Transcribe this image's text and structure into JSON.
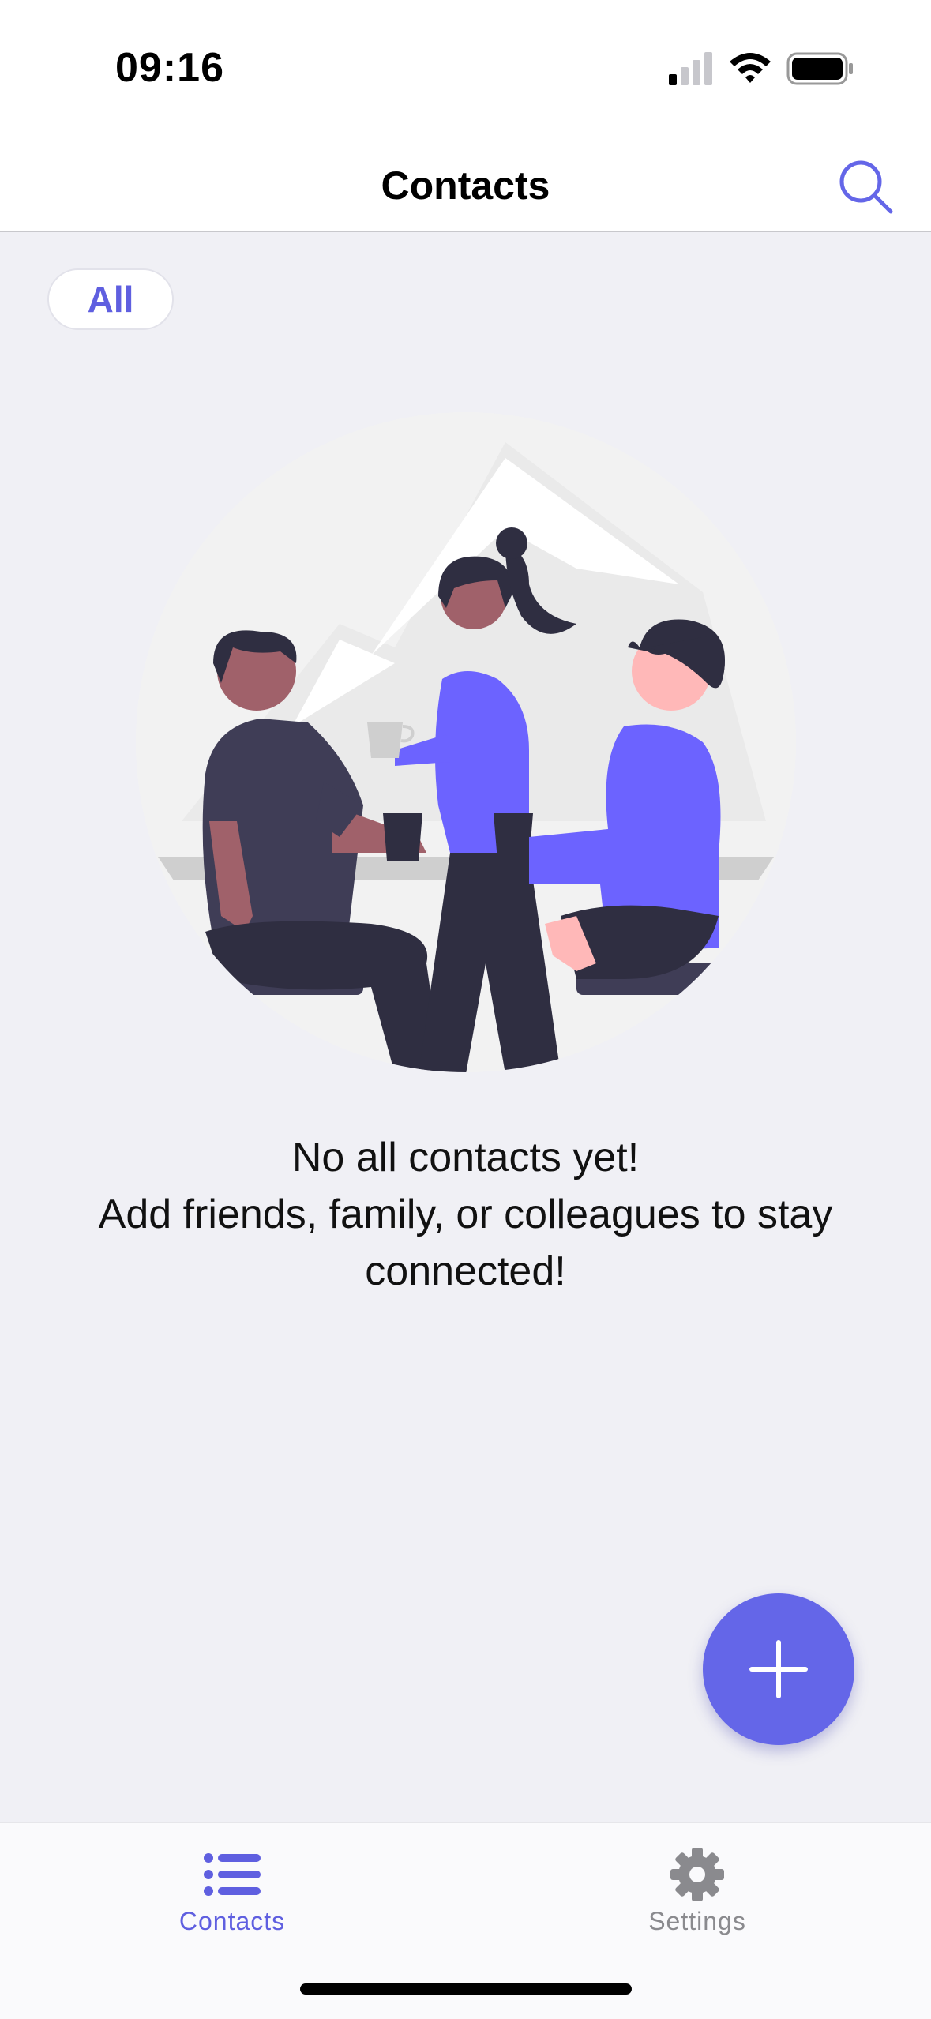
{
  "status_bar": {
    "time": "09:16"
  },
  "nav": {
    "title": "Contacts",
    "search_icon": "search-icon"
  },
  "filter": {
    "chip_label": "All"
  },
  "empty_state": {
    "line1": "No all contacts yet!",
    "line2": "Add friends, family, or colleagues to stay",
    "line3": "connected!"
  },
  "fab": {
    "icon": "plus-icon"
  },
  "tab_bar": {
    "tabs": [
      {
        "label": "Contacts",
        "icon": "list-icon",
        "active": true
      },
      {
        "label": "Settings",
        "icon": "gear-icon",
        "active": false
      }
    ]
  },
  "colors": {
    "accent": "#6466e8",
    "background": "#f0f0f5",
    "inactive": "#8a8a8e"
  }
}
